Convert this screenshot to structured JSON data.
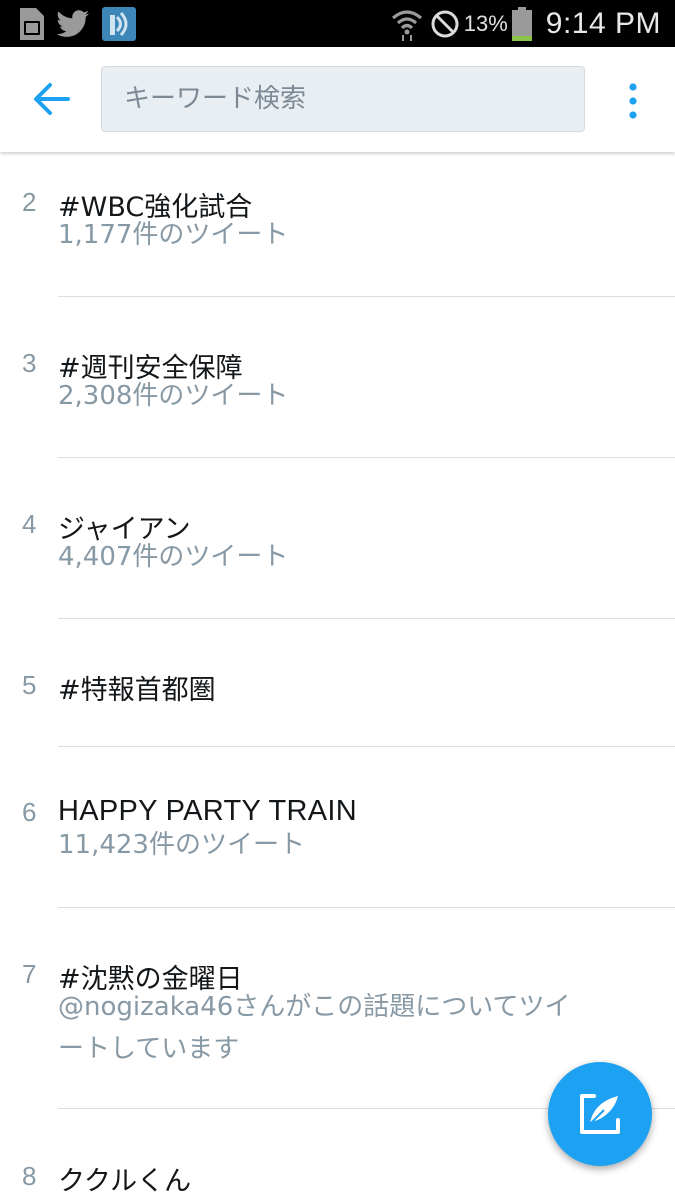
{
  "status_bar": {
    "battery_percent": "13%",
    "time": "9:14 PM",
    "icons": [
      "sim-card-icon",
      "twitter-bird-icon",
      "radio-app-icon",
      "wifi-icon",
      "do-not-disturb-icon",
      "battery-icon"
    ]
  },
  "header": {
    "search_placeholder": "キーワード検索",
    "icons": [
      "back-arrow-icon",
      "more-vertical-icon"
    ],
    "accent_color": "#1da1f2"
  },
  "trends": [
    {
      "rank": "2",
      "name": "#WBC強化試合",
      "meta": "1,177件のツイート"
    },
    {
      "rank": "3",
      "name": "#週刊安全保障",
      "meta": "2,308件のツイート"
    },
    {
      "rank": "4",
      "name": "ジャイアン",
      "meta": "4,407件のツイート"
    },
    {
      "rank": "5",
      "name": "#特報首都圏",
      "meta": ""
    },
    {
      "rank": "6",
      "name": "HAPPY PARTY TRAIN",
      "meta": "11,423件のツイート"
    },
    {
      "rank": "7",
      "name": "#沈黙の金曜日",
      "meta": "@nogizaka46さんがこの話題についてツイートしています"
    },
    {
      "rank": "8",
      "name": "ククルくん",
      "meta": ""
    }
  ],
  "fab": {
    "icon": "compose-tweet-icon"
  }
}
